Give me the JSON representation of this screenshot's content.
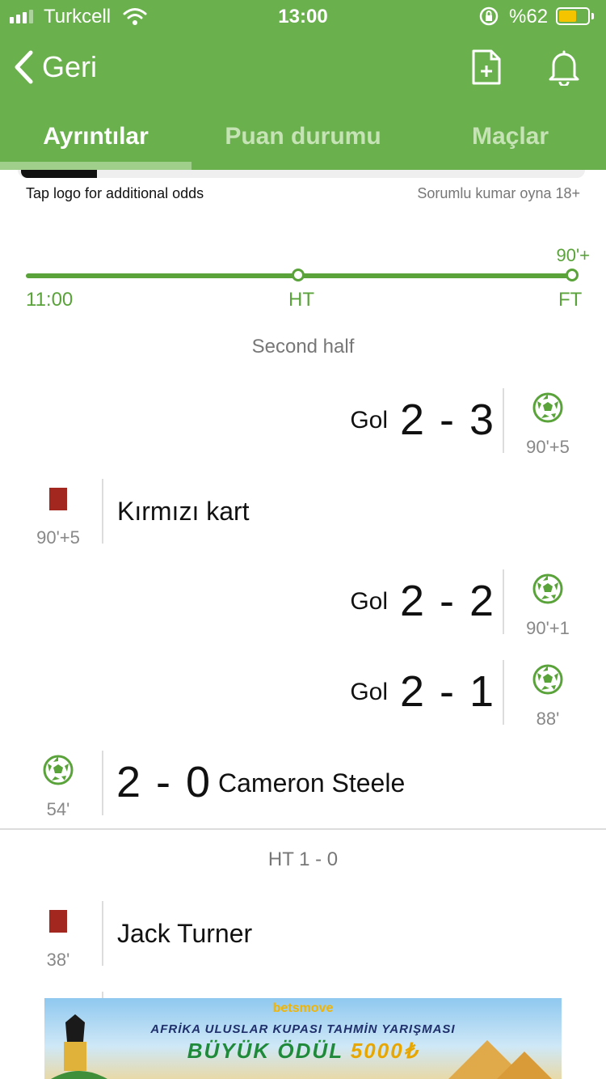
{
  "status_bar": {
    "carrier": "Turkcell",
    "time": "13:00",
    "battery_percent": "%62",
    "battery_level": 0.62
  },
  "nav": {
    "back_label": "Geri"
  },
  "tabs": [
    {
      "label": "Ayrıntılar",
      "active": true
    },
    {
      "label": "Puan durumu",
      "active": false
    },
    {
      "label": "Maçlar",
      "active": false
    }
  ],
  "odds_note": "Tap logo for additional odds",
  "responsible_note": "Sorumlu kumar oyna 18+",
  "timeline": {
    "extra_time": "90'+",
    "start": "11:00",
    "half": "HT",
    "full": "FT"
  },
  "sections": {
    "second_half": "Second half",
    "halftime": "HT 1 - 0"
  },
  "events": [
    {
      "side": "away",
      "type": "goal",
      "label": "Gol",
      "score": "2 - 3",
      "minute": "90'+5"
    },
    {
      "side": "home",
      "type": "red-card",
      "label": "Kırmızı kart",
      "minute": "90'+5"
    },
    {
      "side": "away",
      "type": "goal",
      "label": "Gol",
      "score": "2 - 2",
      "minute": "90'+1"
    },
    {
      "side": "away",
      "type": "goal",
      "label": "Gol",
      "score": "2 - 1",
      "minute": "88'"
    },
    {
      "side": "home",
      "type": "goal",
      "label": "Cameron Steele",
      "score": "2 - 0",
      "minute": "54'"
    },
    {
      "side": "home",
      "type": "red-card",
      "label": "Jack Turner",
      "minute": "38'"
    }
  ],
  "ad": {
    "brand": "betsmove",
    "line1": "AFRİKA ULUSLAR KUPASI TAHMİN YARIŞMASI",
    "line2": "BÜYÜK ÖDÜL",
    "amount": "5000₺"
  },
  "colors": {
    "header_green": "#6ab04c",
    "accent_green": "#5aa33a",
    "red_card": "#a3271f"
  }
}
